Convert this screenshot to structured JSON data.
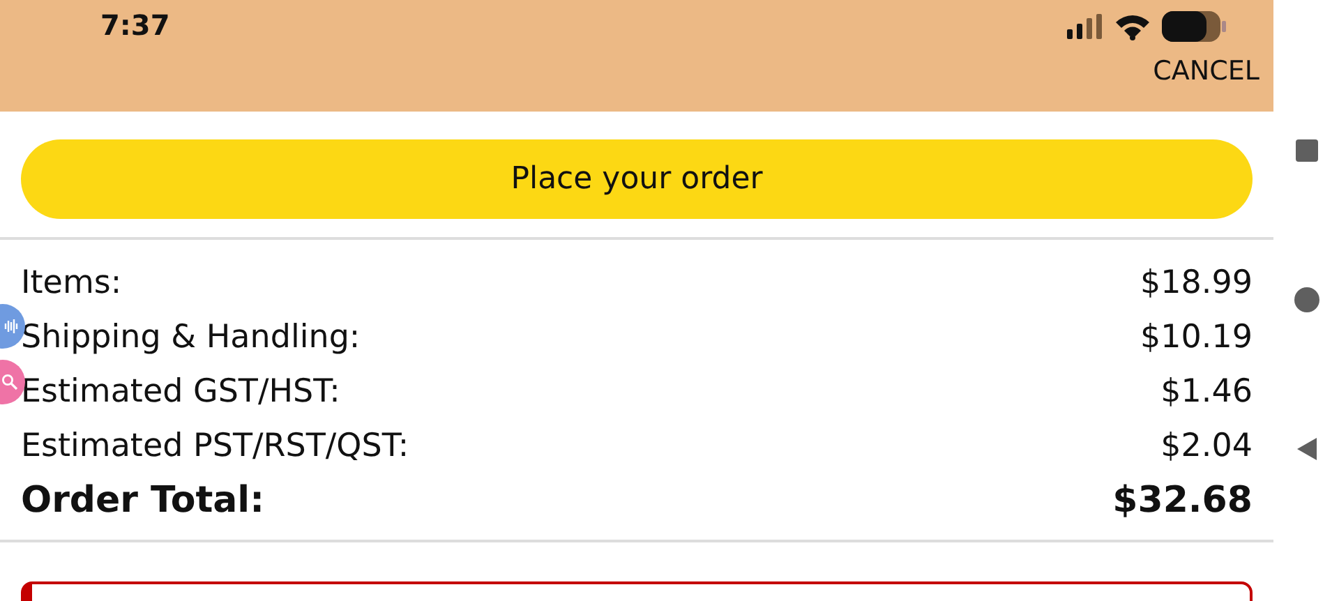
{
  "status_bar": {
    "time": "7:37"
  },
  "header": {
    "cancel": "CANCEL"
  },
  "place_order_button": {
    "label": "Place your order"
  },
  "summary": [
    {
      "kind": "line",
      "label": "Items:",
      "amount": "$18.99"
    },
    {
      "kind": "line",
      "label": "Shipping & Handling:",
      "amount": "$10.19"
    },
    {
      "kind": "line",
      "label": "Estimated GST/HST:",
      "amount": "$1.46"
    },
    {
      "kind": "line",
      "label": "Estimated PST/RST/QST:",
      "amount": "$2.04"
    },
    {
      "kind": "total",
      "label": "Order Total:",
      "amount": "$32.68"
    }
  ]
}
